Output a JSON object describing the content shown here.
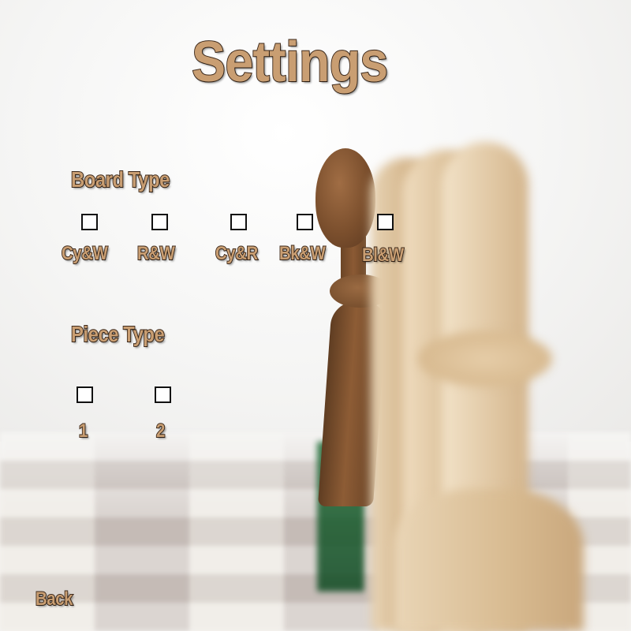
{
  "title": "Settings",
  "board_type": {
    "heading": "Board Type",
    "options": [
      "Cy&W",
      "R&W",
      "Cy&R",
      "Bk&W",
      "Bl&W"
    ]
  },
  "piece_type": {
    "heading": "Piece Type",
    "options": [
      "1",
      "2"
    ]
  },
  "back_label": "Back",
  "colors": {
    "label_fill": "#c99e72",
    "label_outline": "#3e2a1c",
    "checkbox_border": "#111111"
  }
}
